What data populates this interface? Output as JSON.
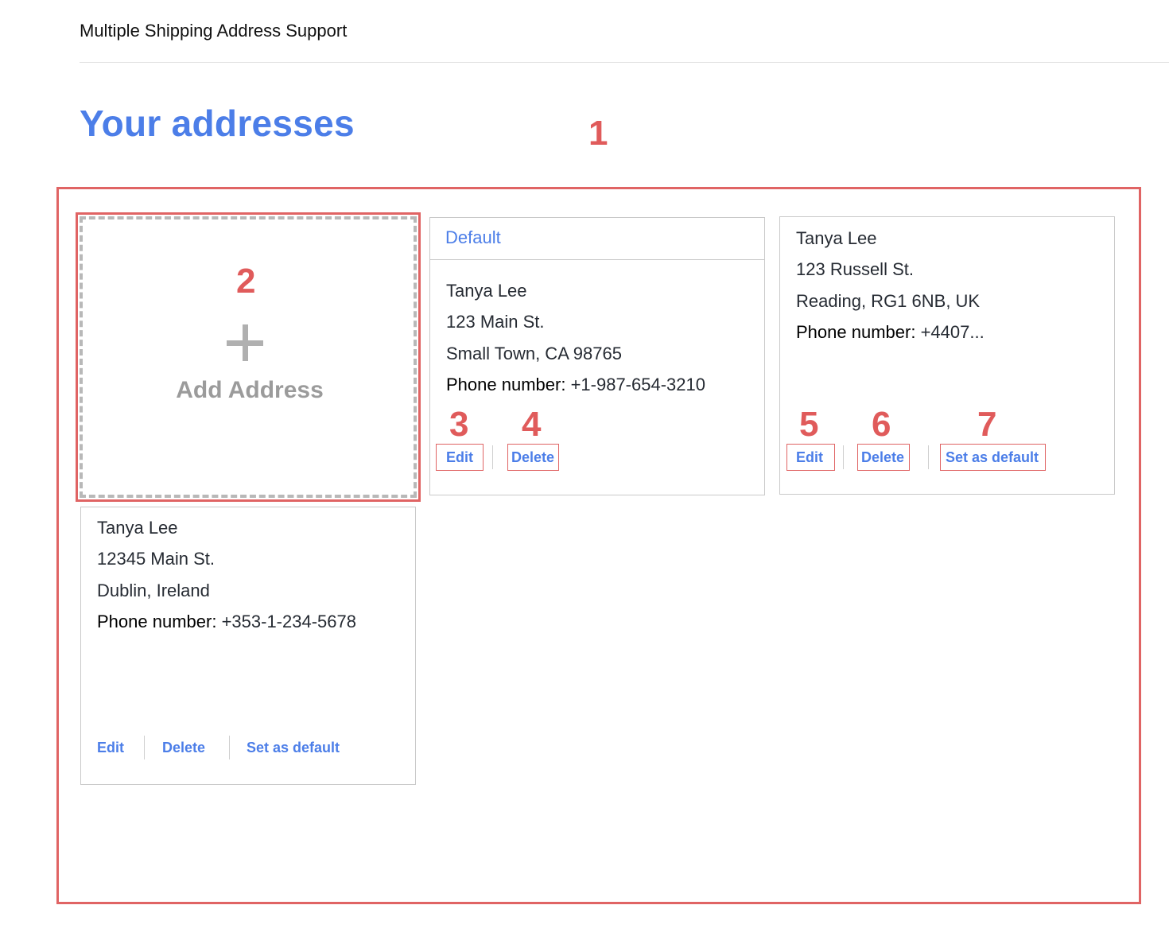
{
  "header": {
    "site_title": "Multiple Shipping Address Support"
  },
  "page": {
    "title": "Your addresses"
  },
  "add_card": {
    "label": "Add Address",
    "icon": "plus-icon"
  },
  "addresses": [
    {
      "badge": "Default",
      "name": "Tanya Lee",
      "street": "123 Main St.",
      "city": "Small Town, CA  98765",
      "phone_label": "Phone number:",
      "phone": "+1-987-654-3210",
      "actions": {
        "edit": "Edit",
        "delete": "Delete"
      }
    },
    {
      "name": "Tanya Lee",
      "street": "123 Russell St.",
      "city": "Reading, RG1 6NB, UK",
      "phone_label": "Phone number:",
      "phone": "+4407...",
      "actions": {
        "edit": "Edit",
        "delete": "Delete",
        "set_default": "Set as default"
      }
    },
    {
      "name": "Tanya Lee",
      "street": "12345 Main St.",
      "city": "Dublin, Ireland",
      "phone_label": "Phone number:",
      "phone": "+353-1-234-5678",
      "actions": {
        "edit": "Edit",
        "delete": "Delete",
        "set_default": "Set as default"
      }
    }
  ],
  "annotations": [
    "1",
    "2",
    "3",
    "4",
    "5",
    "6",
    "7"
  ],
  "colors": {
    "accent": "#4c7ee8",
    "annotation": "#e06464",
    "dashed_border": "#b8b8b8",
    "card_border": "#c9c9c9"
  }
}
